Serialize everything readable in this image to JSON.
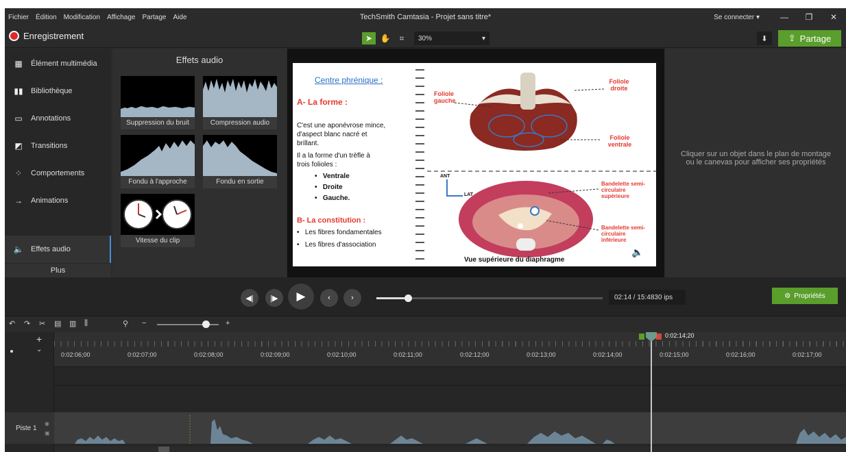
{
  "menubar": {
    "items": [
      "Fichier",
      "Édition",
      "Modification",
      "Affichage",
      "Partage",
      "Aide"
    ],
    "title": "TechSmith Camtasia - Projet sans titre*",
    "connect": "Se connecter ▾",
    "minimize": "—",
    "restore": "❐",
    "close": "✕"
  },
  "toolbar": {
    "record_label": "Enregistrement",
    "zoom": "30%",
    "share_label": "Partage"
  },
  "sidebar": {
    "items": [
      {
        "label": "Élément multimédia",
        "icon": "media-icon"
      },
      {
        "label": "Bibliothèque",
        "icon": "library-icon"
      },
      {
        "label": "Annotations",
        "icon": "annotation-icon"
      },
      {
        "label": "Transitions",
        "icon": "transition-icon"
      },
      {
        "label": "Comportements",
        "icon": "behavior-icon"
      },
      {
        "label": "Animations",
        "icon": "animation-icon"
      },
      {
        "label": "Effets audio",
        "icon": "audio-icon"
      }
    ],
    "more": "Plus"
  },
  "effects": {
    "title": "Effets audio",
    "tiles": [
      "Suppression du bruit",
      "Compression audio",
      "Fondu à l'approche",
      "Fondu en sortie",
      "Vitesse du clip"
    ]
  },
  "slide": {
    "heading": "Centre phrénique :",
    "a_title": "A- La forme :",
    "a_text1": "C'est une aponévrose mince,",
    "a_text2": "d'aspect blanc nacré et",
    "a_text3": "brillant.",
    "a_text4": "Il a la forme d'un trèfle à",
    "a_text5": "trois folioles :",
    "bullets": [
      "Ventrale",
      "Droite",
      "Gauche."
    ],
    "b_title": "B- La constitution :",
    "b_items": [
      "Les fibres fondamentales",
      "Les fibres d'association"
    ],
    "lbl_gauche": "Foliole gauche",
    "lbl_droite": "Foliole droite",
    "lbl_ventrale": "Foliole ventrale",
    "ant": "ANT",
    "lat": "LAT",
    "band_sup": "Bandelette semi-circulaire supérieure",
    "band_inf": "Bandelette semi-circulaire inférieure",
    "caption": "Vue supérieure du diaphragme"
  },
  "properties": {
    "hint": "Cliquer sur un objet dans le plan de montage ou le canevas pour afficher ses propriétés",
    "button": "Propriétés"
  },
  "playback": {
    "time": "02:14 / 15:48",
    "fps": "30 ips",
    "progress": 0.14
  },
  "timeline": {
    "ruler": [
      "0:02:06;00",
      "0:02:07;00",
      "0:02:08;00",
      "0:02:09;00",
      "0:02:10;00",
      "0:02:11;00",
      "0:02:12;00",
      "0:02:13;00",
      "0:02:14;00",
      "0:02:15;00",
      "0:02:16;00",
      "0:02:17;00"
    ],
    "playhead_label": "0:02:14;20",
    "track": "Piste 1"
  },
  "colors": {
    "accent": "#5a9e2c",
    "record": "#e0282b",
    "playhead_marker": "#6e9a8a"
  }
}
